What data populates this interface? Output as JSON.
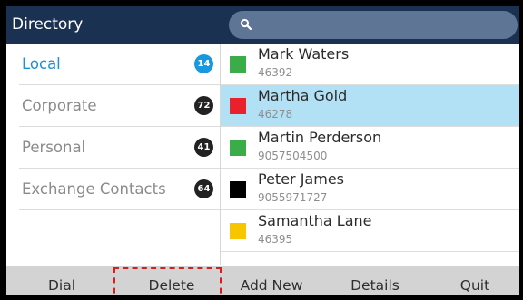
{
  "header": {
    "title": "Directory"
  },
  "search": {
    "value": ""
  },
  "sidebar": {
    "items": [
      {
        "label": "Local",
        "count": "14",
        "active": true
      },
      {
        "label": "Corporate",
        "count": "72",
        "active": false
      },
      {
        "label": "Personal",
        "count": "41",
        "active": false
      },
      {
        "label": "Exchange Contacts",
        "count": "64",
        "active": false
      }
    ]
  },
  "contacts": [
    {
      "name": "Mark Waters",
      "number": "46392",
      "color": "#3aad48",
      "selected": false
    },
    {
      "name": "Martha Gold",
      "number": "46278",
      "color": "#e8212d",
      "selected": true
    },
    {
      "name": "Martin Perderson",
      "number": "9057504500",
      "color": "#3aad48",
      "selected": false
    },
    {
      "name": "Peter James",
      "number": "9055971727",
      "color": "#000000",
      "selected": false
    },
    {
      "name": "Samantha Lane",
      "number": "46395",
      "color": "#f7c600",
      "selected": false
    }
  ],
  "softkeys": {
    "dial": "Dial",
    "delete": "Delete",
    "add_new": "Add New",
    "details": "Details",
    "quit": "Quit"
  },
  "colors": {
    "header_bg": "#1b3152",
    "selected_row": "#b2e0f5",
    "active_accent": "#1a98de",
    "highlight_border": "#d21f1f"
  }
}
